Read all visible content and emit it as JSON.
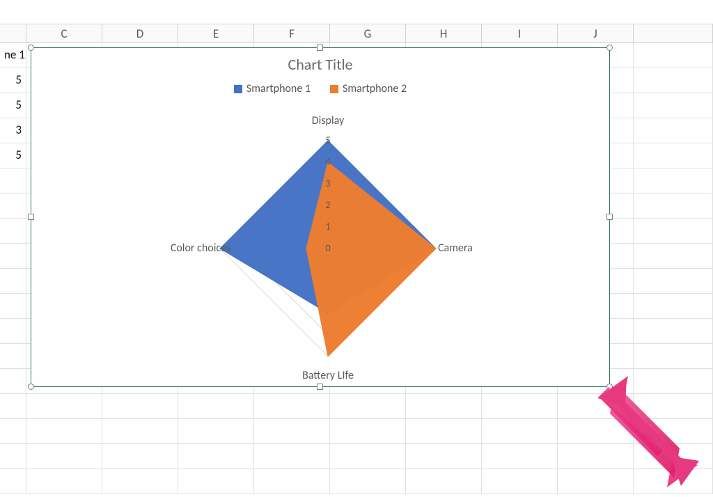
{
  "columns": [
    {
      "letter": "",
      "width": 38
    },
    {
      "letter": "C",
      "width": 109
    },
    {
      "letter": "D",
      "width": 109
    },
    {
      "letter": "E",
      "width": 109
    },
    {
      "letter": "F",
      "width": 109
    },
    {
      "letter": "G",
      "width": 109
    },
    {
      "letter": "H",
      "width": 109
    },
    {
      "letter": "I",
      "width": 109
    },
    {
      "letter": "J",
      "width": 109
    },
    {
      "letter": "",
      "width": 114
    }
  ],
  "visible_cells": {
    "r1c1": "ne 1",
    "r2c1": "5",
    "r3c1": "5",
    "r4c1": "3",
    "r5c1": "5"
  },
  "chart": {
    "title": "Chart Title",
    "legend": [
      {
        "name": "Smartphone 1",
        "color": "#4472C4"
      },
      {
        "name": "Smartphone 2",
        "color": "#ED7D31"
      }
    ],
    "axis_labels": [
      "Display",
      "Camera",
      "Battery LIfe",
      "Color choices"
    ],
    "ticks": [
      "0",
      "1",
      "2",
      "3",
      "4",
      "5"
    ]
  },
  "chart_data": {
    "type": "radar",
    "title": "Chart Title",
    "categories": [
      "Display",
      "Camera",
      "Battery LIfe",
      "Color choices"
    ],
    "series": [
      {
        "name": "Smartphone 1",
        "color": "#4472C4",
        "values": [
          5,
          5,
          3,
          5
        ]
      },
      {
        "name": "Smartphone 2",
        "color": "#ED7D31",
        "values": [
          4,
          5,
          5,
          1
        ]
      }
    ],
    "max": 5,
    "ticks": [
      0,
      1,
      2,
      3,
      4,
      5
    ]
  },
  "colors": {
    "series1": "#4472C4",
    "series2": "#ED7D31",
    "arrow": "#E6397F"
  }
}
